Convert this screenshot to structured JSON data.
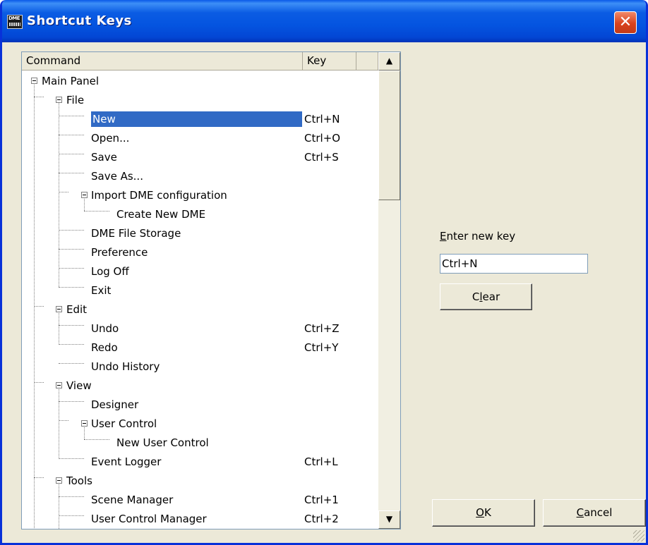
{
  "window": {
    "title": "Shortcut Keys",
    "icon": "DME",
    "close_glyph": "✕"
  },
  "table": {
    "columns": [
      "Command",
      "Key"
    ],
    "rows": [
      {
        "label": "Main Panel",
        "key": ""
      },
      {
        "label": "File",
        "key": ""
      },
      {
        "label": "New",
        "key": "Ctrl+N",
        "selected": true
      },
      {
        "label": "Open...",
        "key": "Ctrl+O"
      },
      {
        "label": "Save",
        "key": "Ctrl+S"
      },
      {
        "label": "Save As...",
        "key": ""
      },
      {
        "label": "Import DME configuration",
        "key": ""
      },
      {
        "label": "Create New DME",
        "key": ""
      },
      {
        "label": "DME File Storage",
        "key": ""
      },
      {
        "label": "Preference",
        "key": ""
      },
      {
        "label": "Log Off",
        "key": ""
      },
      {
        "label": "Exit",
        "key": ""
      },
      {
        "label": "Edit",
        "key": ""
      },
      {
        "label": "Undo",
        "key": "Ctrl+Z"
      },
      {
        "label": "Redo",
        "key": "Ctrl+Y"
      },
      {
        "label": "Undo History",
        "key": ""
      },
      {
        "label": "View",
        "key": ""
      },
      {
        "label": "Designer",
        "key": ""
      },
      {
        "label": "User Control",
        "key": ""
      },
      {
        "label": "New User Control",
        "key": ""
      },
      {
        "label": "Event Logger",
        "key": "Ctrl+L"
      },
      {
        "label": "Tools",
        "key": ""
      },
      {
        "label": "Scene Manager",
        "key": "Ctrl+1"
      },
      {
        "label": "User Control Manager",
        "key": "Ctrl+2"
      }
    ]
  },
  "scrollbar": {
    "up_glyph": "▲",
    "down_glyph": "▼"
  },
  "key_editor": {
    "label_mnemonic": "E",
    "label_rest": "nter new key",
    "value": "Ctrl+N",
    "clear_pre": "C",
    "clear_mnemonic": "l",
    "clear_post": "ear"
  },
  "buttons": {
    "ok_mnemonic": "O",
    "ok_rest": "K",
    "cancel_mnemonic": "C",
    "cancel_rest": "ancel"
  }
}
